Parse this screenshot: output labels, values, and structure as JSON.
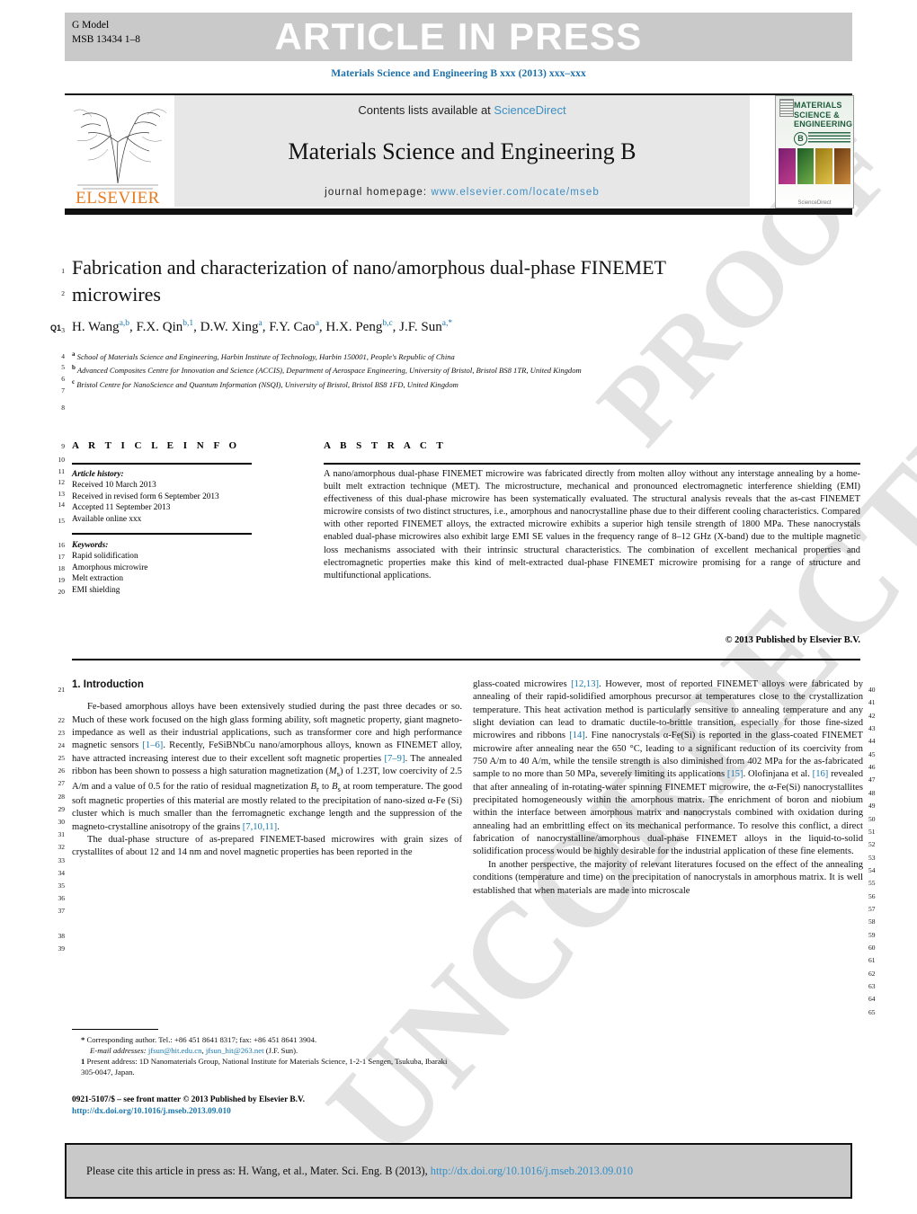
{
  "header": {
    "g_model_label": "G Model",
    "manuscript_id": "MSB 13434 1–8",
    "article_in_press": "ARTICLE IN PRESS",
    "journal_citation_line": "Materials Science and Engineering B xxx (2013) xxx–xxx"
  },
  "masthead": {
    "contents_prefix": "Contents lists available at ",
    "sciencedirect": "ScienceDirect",
    "journal_title": "Materials Science and Engineering B",
    "homepage_label": "journal homepage:",
    "homepage_url": "www.elsevier.com/locate/mseb",
    "publisher_logo": "ELSEVIER",
    "cover_line1": "MATERIALS",
    "cover_line2": "SCIENCE &",
    "cover_line3": "ENGINEERING",
    "cover_badge": "B",
    "cover_footer": "ScienceDirect"
  },
  "article": {
    "title": "Fabrication and characterization of nano/amorphous dual-phase FINEMET microwires",
    "query_tag": "Q1",
    "authors_html": "H. Wang<sup>a,b</sup>, F.X. Qin<sup>b,1</sup>, D.W. Xing<sup>a</sup>, F.Y. Cao<sup>a</sup>, H.X. Peng<sup>b,c</sup>, J.F. Sun<sup>a,*</sup>",
    "affiliations": [
      {
        "marker": "a",
        "text": "School of Materials Science and Engineering, Harbin Institute of Technology, Harbin 150001, People's Republic of China"
      },
      {
        "marker": "b",
        "text": "Advanced Composites Centre for Innovation and Science (ACCIS), Department of Aerospace Engineering, University of Bristol, Bristol BS8 1TR, United Kingdom"
      },
      {
        "marker": "c",
        "text": "Bristol Centre for NanoScience and Quantum Information (NSQI), University of Bristol, Bristol BS8 1FD, United Kingdom"
      }
    ]
  },
  "article_info": {
    "heading": "A R T I C L E   I N F O",
    "history_label": "Article history:",
    "history": [
      "Received 10 March 2013",
      "Received in revised form 6 September 2013",
      "Accepted 11 September 2013",
      "Available online xxx"
    ],
    "keywords_label": "Keywords:",
    "keywords": [
      "Rapid solidification",
      "Amorphous microwire",
      "Melt extraction",
      "EMI shielding"
    ]
  },
  "abstract": {
    "heading": "A B S T R A C T",
    "text": "A nano/amorphous dual-phase FINEMET microwire was fabricated directly from molten alloy without any interstage annealing by a home-built melt extraction technique (MET). The microstructure, mechanical and pronounced electromagnetic interference shielding (EMI) effectiveness of this dual-phase microwire has been systematically evaluated. The structural analysis reveals that the as-cast FINEMET microwire consists of two distinct structures, i.e., amorphous and nanocrystalline phase due to their different cooling characteristics. Compared with other reported FINEMET alloys, the extracted microwire exhibits a superior high tensile strength of 1800 MPa. These nanocrystals enabled dual-phase microwires also exhibit large EMI SE values in the frequency range of 8–12 GHz (X-band) due to the multiple magnetic loss mechanisms associated with their intrinsic structural characteristics. The combination of excellent mechanical properties and electromagnetic properties make this kind of melt-extracted dual-phase FINEMET microwire promising for a range of structure and multifunctional applications.",
    "copyright": "© 2013 Published by Elsevier B.V."
  },
  "body": {
    "section_heading": "1. Introduction",
    "left_paragraph_1_html": "Fe-based amorphous alloys have been extensively studied during the past three decades or so. Much of these work focused on the high glass forming ability, soft magnetic property, giant magneto-impedance as well as their industrial applications, such as transformer core and high performance magnetic sensors <span class=\"ref\">[1–6]</span>. Recently, FeSiBNbCu nano/amorphous alloys, known as FINEMET alloy, have attracted increasing interest due to their excellent soft magnetic properties <span class=\"ref\">[7–9]</span>. The annealed ribbon has been shown to possess a high saturation magnetization (<i>M</i><sub>s</sub>) of 1.23T, low coercivity of 2.5 A/m and a value of 0.5 for the ratio of residual magnetization <i>B</i><sub>r</sub> to <i>B</i><sub>s</sub> at room temperature. The good soft magnetic properties of this material are mostly related to the precipitation of nano-sized α-Fe (Si) cluster which is much smaller than the ferromagnetic exchange length and the suppression of the magneto-crystalline anisotropy of the grains <span class=\"ref\">[7,10,11]</span>.",
    "left_paragraph_2_html": "The dual-phase structure of as-prepared FINEMET-based microwires with grain sizes of crystallites of about 12 and 14 nm and novel magnetic properties has been reported in the",
    "right_paragraph_1_html": "glass-coated microwires <span class=\"ref\">[12,13]</span>. However, most of reported FINEMET alloys were fabricated by annealing of their rapid-solidified amorphous precursor at temperatures close to the crystallization temperature. This heat activation method is particularly sensitive to annealing temperature and any slight deviation can lead to dramatic ductile-to-brittle transition, especially for those fine-sized microwires and ribbons <span class=\"ref\">[14]</span>. Fine nanocrystals α-Fe(Si) is reported in the glass-coated FINEMET microwire after annealing near the 650 °C, leading to a significant reduction of its coercivity from 750 A/m to 40 A/m, while the tensile strength is also diminished from 402 MPa for the as-fabricated sample to no more than 50 MPa, severely limiting its applications <span class=\"ref\">[15]</span>. Olofinjana et al. <span class=\"ref\">[16]</span> revealed that after annealing of in-rotating-water spinning FINEMET microwire, the α-Fe(Si) nanocrystallites precipitated homogeneously within the amorphous matrix. The enrichment of boron and niobium within the interface between amorphous matrix and nanocrystals combined with oxidation during annealing had an embrittling effect on its mechanical performance. To resolve this conflict, a direct fabrication of nanocrystalline/amorphous dual-phase FINEMET alloys in the liquid-to-solid solidification process would be highly desirable for the industrial application of these fine elements.",
    "right_paragraph_2_html": "In another perspective, the majority of relevant literatures focused on the effect of the annealing conditions (temperature and time) on the precipitation of nanocrystals in amorphous matrix. It is well established that when materials are made into microscale"
  },
  "footnote": {
    "corresponding_html": "<b>*</b> Corresponding author. Tel.: +86 451 8641 8317; fax: +86 451 8641 3904.",
    "email_label": "E-mail addresses:",
    "email_1": "jfsun@hit.edu.cn",
    "email_2": "jfsun_hit@263.net",
    "email_suffix": "(J.F. Sun).",
    "present_address_html": "<b>1</b> Present address: 1D Nanomaterials Group, National Institute for Materials Science, 1-2-1 Sengen, Tsukuba, Ibaraki 305-0047, Japan."
  },
  "issn_block": {
    "line1": "0921-5107/$ – see front matter © 2013 Published by Elsevier B.V.",
    "doi": "http://dx.doi.org/10.1016/j.mseb.2013.09.010"
  },
  "cite_box": {
    "prefix": "Please cite this article in press as: H. Wang, et al., Mater. Sci. Eng. B (2013), ",
    "doi": "http://dx.doi.org/10.1016/j.mseb.2013.09.010"
  },
  "line_numbers": {
    "left": [
      "1",
      "2",
      "3",
      "4",
      "5",
      "6",
      "7",
      "8",
      "9",
      "10",
      "11",
      "12",
      "13",
      "14",
      "15",
      "16",
      "17",
      "18",
      "19",
      "20",
      "21",
      "22",
      "23",
      "24",
      "25",
      "26",
      "27",
      "28",
      "29",
      "30",
      "31",
      "32",
      "33",
      "34",
      "35",
      "36",
      "37",
      "38",
      "39"
    ],
    "right": [
      "40",
      "41",
      "42",
      "43",
      "44",
      "45",
      "46",
      "47",
      "48",
      "49",
      "50",
      "51",
      "52",
      "53",
      "54",
      "55",
      "56",
      "57",
      "58",
      "59",
      "60",
      "61",
      "62",
      "63",
      "64",
      "65"
    ]
  },
  "watermark": {
    "text_1": "PROOF",
    "text_2": "UNCORRECTED"
  },
  "colors": {
    "link": "#1a77ad",
    "band_grey": "#c9c9c9",
    "masthead_grey": "#e7e7e7"
  }
}
